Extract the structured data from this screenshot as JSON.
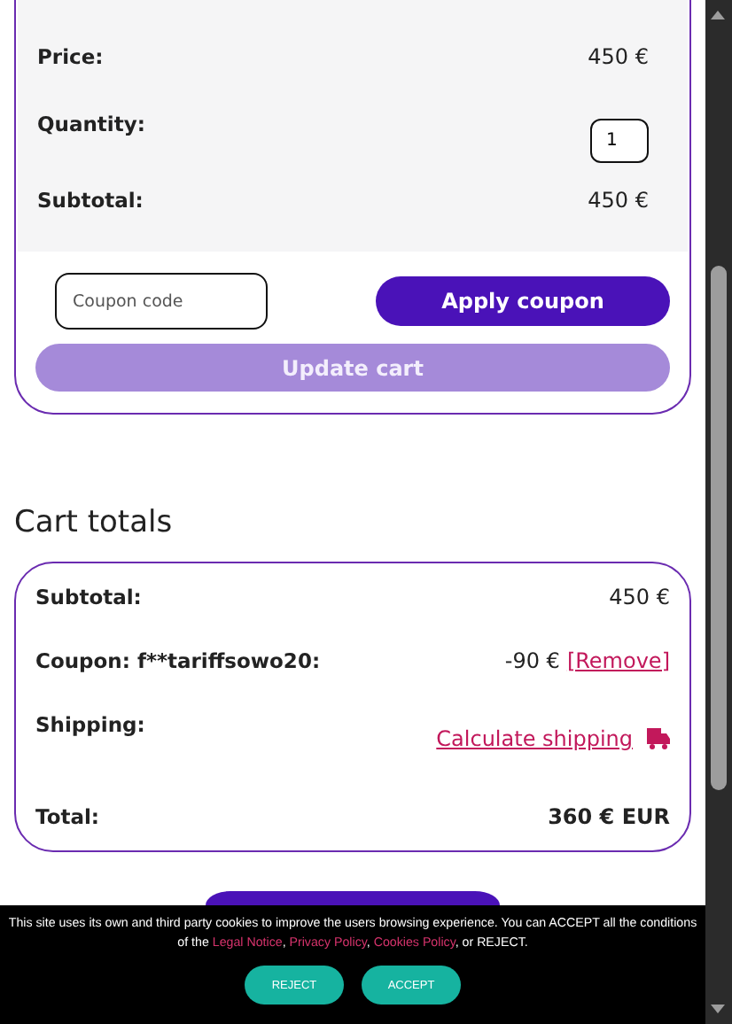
{
  "cart_item": {
    "rows": [
      {
        "kind": "text",
        "label": "Price:",
        "value": "450 €"
      },
      {
        "kind": "quantity",
        "label": "Quantity:",
        "value": "1"
      },
      {
        "kind": "text",
        "label": "Subtotal:",
        "value": "450 €"
      }
    ]
  },
  "coupon": {
    "placeholder": "Coupon code",
    "apply_button": "Apply coupon",
    "update_button": "Update cart",
    "update_disabled": true
  },
  "cart_totals": {
    "title": "Cart totals",
    "rows": [
      {
        "kind": "text",
        "label": "Subtotal:",
        "value": "450 €"
      },
      {
        "kind": "coupon",
        "label": "Coupon: f**tariffsowo20:",
        "value": "-90 €",
        "link": "[Remove]"
      },
      {
        "kind": "shipping",
        "label": "Shipping:",
        "link": "Calculate shipping"
      },
      {
        "kind": "total",
        "label": "Total:",
        "value": "360 € EUR"
      }
    ]
  },
  "cookie_banner": {
    "parts": [
      {
        "kind": "text",
        "text": "This site uses its own and third party cookies to improve the users browsing experience. You can ACCEPT all the conditions of the "
      },
      {
        "kind": "link",
        "text": "Legal Notice"
      },
      {
        "kind": "text",
        "text": ", "
      },
      {
        "kind": "link",
        "text": "Privacy Policy"
      },
      {
        "kind": "text",
        "text": ", "
      },
      {
        "kind": "link",
        "text": "Cookies Policy"
      },
      {
        "kind": "text",
        "text": ", or REJECT."
      }
    ],
    "buttons": [
      "REJECT",
      "ACCEPT"
    ]
  }
}
